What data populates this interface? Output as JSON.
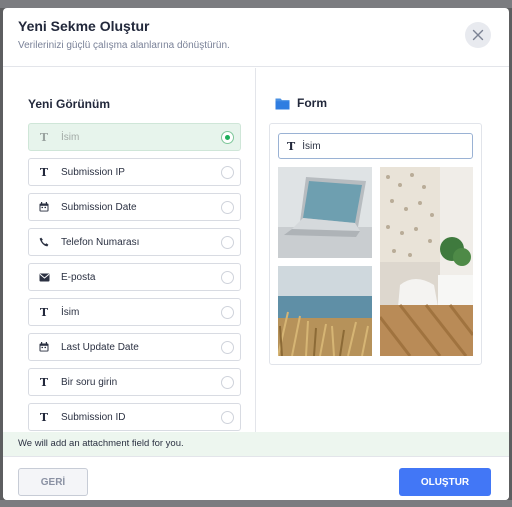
{
  "modal": {
    "title": "Yeni Sekme Oluştur",
    "subtitle": "Verilerinizi güçlü çalışma alanlarına dönüştürün."
  },
  "left_panel": {
    "title": "Yeni Görünüm",
    "fields": [
      {
        "label": "İsim",
        "icon": "text-icon",
        "selected": true
      },
      {
        "label": "Submission IP",
        "icon": "text-icon",
        "selected": false
      },
      {
        "label": "Submission Date",
        "icon": "calendar-icon",
        "selected": false
      },
      {
        "label": "Telefon Numarası",
        "icon": "phone-icon",
        "selected": false
      },
      {
        "label": "E-posta",
        "icon": "envelope-icon",
        "selected": false
      },
      {
        "label": "İsim",
        "icon": "text-icon",
        "selected": false
      },
      {
        "label": "Last Update Date",
        "icon": "calendar-icon",
        "selected": false
      },
      {
        "label": "Bir soru girin",
        "icon": "text-icon",
        "selected": false
      },
      {
        "label": "Submission ID",
        "icon": "text-icon",
        "selected": false
      }
    ]
  },
  "right_panel": {
    "title": "Form",
    "field_label": "İsim"
  },
  "notice": "We will add an attachment field for you.",
  "footer": {
    "back_label": "GERİ",
    "create_label": "OLUŞTUR"
  },
  "colors": {
    "accent": "#4277f6",
    "selected_bg": "#e7f4ec",
    "radio_on": "#1fae5b"
  }
}
